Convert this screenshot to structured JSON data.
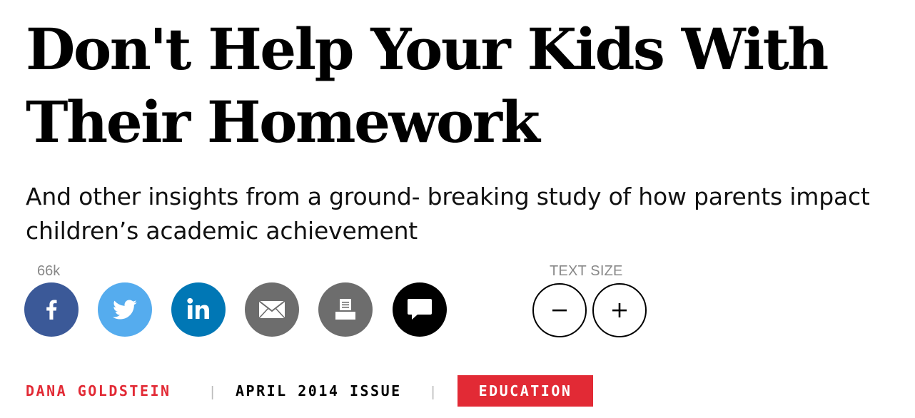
{
  "article": {
    "headline": "Don't Help Your Kids With Their Homework",
    "subhead": "And other insights from a ground- breaking study of how parents impact children’s academic achievement"
  },
  "share": {
    "count": "66k",
    "buttons": [
      {
        "name": "facebook",
        "icon": "facebook-icon",
        "color": "#3b5998"
      },
      {
        "name": "twitter",
        "icon": "twitter-icon",
        "color": "#55acee"
      },
      {
        "name": "linkedin",
        "icon": "linkedin-icon",
        "color": "#0077b5"
      },
      {
        "name": "email",
        "icon": "envelope-icon",
        "color": "#6d6d6d"
      },
      {
        "name": "print",
        "icon": "printer-icon",
        "color": "#6d6d6d"
      },
      {
        "name": "comments",
        "icon": "speech-bubble-icon",
        "color": "#000000"
      }
    ]
  },
  "text_size": {
    "label": "TEXT SIZE",
    "decrease_icon": "minus-icon",
    "increase_icon": "plus-icon"
  },
  "byline": {
    "author": "DANA GOLDSTEIN",
    "separator": "|",
    "issue": "APRIL 2014 ISSUE",
    "section": "EDUCATION"
  },
  "colors": {
    "accent_red": "#e22a35",
    "muted_gray": "#888888"
  }
}
